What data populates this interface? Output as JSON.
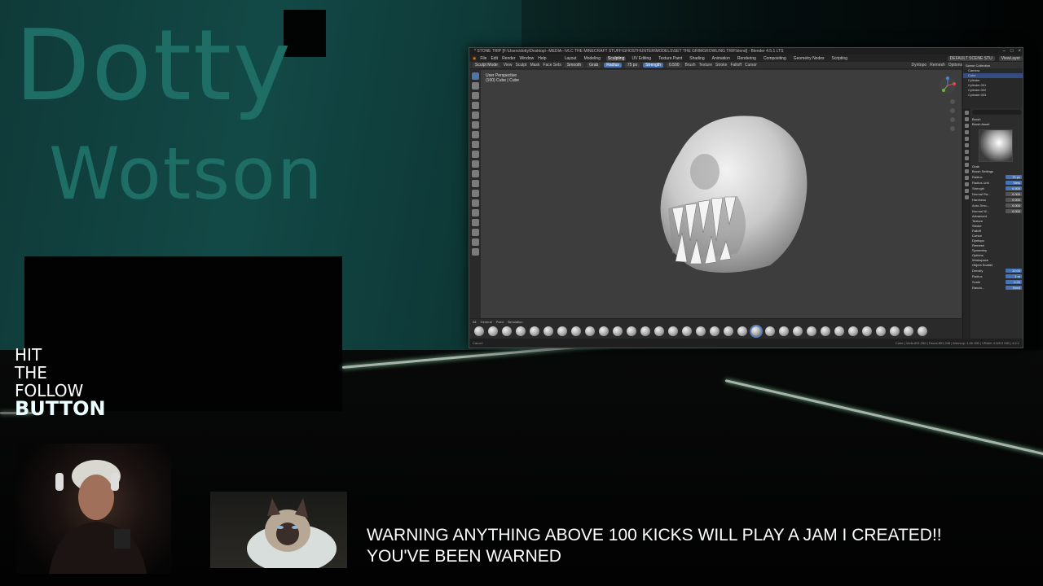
{
  "overlay": {
    "logo_line1": "Dotty",
    "logo_line2": "Wotson",
    "follow_lines": [
      "HIT",
      "THE",
      "FOLLOW"
    ],
    "follow_button": "BUTTON",
    "warning_line1": "WARNING ANYTHING ABOVE 100 KICKS WILL PLAY A JAM I CREATED!!",
    "warning_line2": "YOU'VE BEEN WARNED"
  },
  "blender": {
    "title": "* STONE TRIP [F:\\Users\\dotty\\Desktop\\--MEDIA--\\VLC THE MINECRAFT STUFF\\GHOSTHUNTER\\MODELS\\SET THE GRIMGROWLING TRIP.blend] - Blender 4.5.1 LTS",
    "menu": [
      "File",
      "Edit",
      "Render",
      "Window",
      "Help"
    ],
    "workspaces": [
      "Layout",
      "Modeling",
      "Sculpting",
      "UV Editing",
      "Texture Paint",
      "Shading",
      "Animation",
      "Rendering",
      "Compositing",
      "Geometry Nodes",
      "Scripting"
    ],
    "active_workspace": "Sculpting",
    "scene": "DEFAULT SCENE STU",
    "view_layer": "ViewLayer",
    "header_modes": [
      "Sculpt Mode",
      "View",
      "Sculpt",
      "Mask",
      "Face Sets"
    ],
    "brush_name": "Smooth",
    "tool_settings": {
      "tool": "Grab",
      "radius_label": "Radius",
      "radius_value": "75 px",
      "strength_label": "Strength",
      "strength_value": "0.500",
      "brush_menu": "Brush",
      "texture_menu": "Texture",
      "stroke_menu": "Stroke",
      "falloff_menu": "Falloff",
      "cursor_menu": "Cursor",
      "dyntopo": "Dyntopo",
      "remesh": "Remesh",
      "options": "Options"
    },
    "viewport": {
      "perspective": "User Perspective",
      "object": "(100) Cube | Cube"
    },
    "brush_tabs": [
      "All",
      "General",
      "Paint",
      "Simulation"
    ],
    "outliner": {
      "title": "Scene Collection",
      "rows": [
        "Camera",
        "Cube",
        "Cylinder",
        "Cylinder.001",
        "Cylinder.002",
        "Cylinder.003"
      ]
    },
    "properties": {
      "brush_header": "Brush",
      "brush_asset": "Brush Asset",
      "brush_asset_name": "Grab",
      "brush_settings": "Brush Settings",
      "rows": [
        {
          "label": "Radius",
          "value": "75 px"
        },
        {
          "label": "Radius Unit",
          "value": "View"
        },
        {
          "label": "Strength",
          "value": "0.500"
        },
        {
          "label": "Normal Ra...",
          "value": "0.000"
        },
        {
          "label": "Hardness",
          "value": "0.000"
        },
        {
          "label": "Auto-Smo...",
          "value": "0.000"
        },
        {
          "label": "Normal W...",
          "value": "0.000"
        }
      ],
      "sections": [
        "Advanced",
        "Texture",
        "Stroke",
        "Falloff",
        "Cursor",
        "Dyntopo",
        "Remesh",
        "Symmetry",
        "Options",
        "Workspace",
        "Object Scatter"
      ],
      "scatter_rows": [
        {
          "label": "Density",
          "value": "10.00"
        },
        {
          "label": "Radius",
          "value": "1 m"
        },
        {
          "label": "Scale",
          "value": "0.20"
        },
        {
          "label": "Rando...",
          "value": "Seed"
        }
      ]
    },
    "status_left": "Cancel",
    "status_right": "Cube | Verts:891,250 | Faces:891,248 | Memory: 1.66 GiB | VRAM: 4.3/8.0 GiB | 4.5.1"
  },
  "colors": {
    "wall": "#124946",
    "logo": "#1e6e66",
    "blender_accent": "#4772b3",
    "viewport_bg": "#3d3d3d"
  }
}
